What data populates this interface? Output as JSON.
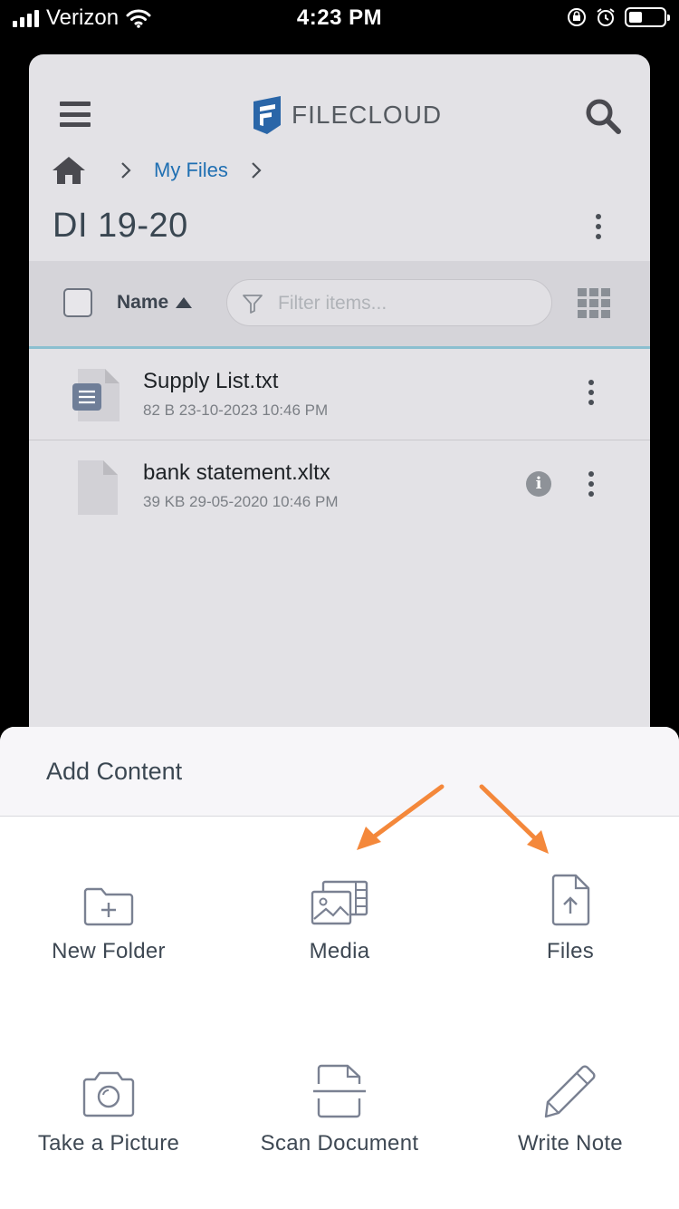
{
  "status_bar": {
    "carrier": "Verizon",
    "time": "4:23 PM",
    "battery_level": 0.4
  },
  "app": {
    "brand": "FILECLOUD",
    "breadcrumb": {
      "current": "My Files"
    },
    "folder_title": "DI 19-20",
    "toolbar": {
      "sort_label": "Name",
      "filter_placeholder": "Filter items..."
    },
    "files": [
      {
        "name": "Supply List.txt",
        "meta": "82 B 23-10-2023 10:46 PM",
        "icon": "text-file-icon"
      },
      {
        "name": "bank statement.xltx",
        "meta": "39 KB 29-05-2020 10:46 PM",
        "icon": "generic-file-icon",
        "info": "i"
      }
    ]
  },
  "sheet": {
    "title": "Add Content",
    "actions": [
      {
        "label": "New Folder",
        "icon": "folder-plus-icon"
      },
      {
        "label": "Media",
        "icon": "media-icon"
      },
      {
        "label": "Files",
        "icon": "file-upload-icon"
      },
      {
        "label": "Take a Picture",
        "icon": "camera-icon"
      },
      {
        "label": "Scan Document",
        "icon": "scan-icon"
      },
      {
        "label": "Write Note",
        "icon": "pencil-icon"
      }
    ]
  },
  "colors": {
    "accent": "#1f6fb2",
    "annotation_arrow": "#f4883b",
    "icon": "#7a8192"
  }
}
